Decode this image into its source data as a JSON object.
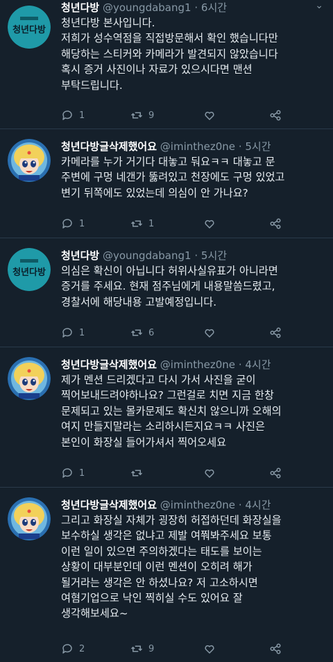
{
  "tweets": [
    {
      "avatar": "youngdabang-logo",
      "avatar_text": "청년다방",
      "name": "청년다방",
      "handle": "@youngdabang1",
      "time": "· 6시간",
      "text": "청년다방 본사입니다.\n저희가 성수역점을 직접방문해서 확인 했습니다만\n해당하는 스티커와 카메라가 발견되지 않았습니다\n혹시 증거 사진이나 자료가 있으시다면 맨션\n부탁드립니다.",
      "replies": "1",
      "retweets": "9",
      "likes": ""
    },
    {
      "avatar": "sailor-moon-avatar",
      "name": "청년다방글삭제했어요",
      "handle": "@iminthez0ne",
      "time": "· 5시간",
      "text": "카메라를 누가 거기다 대놓고 둬요ㅋㅋ 대놓고 문\n주변에 구멍 네갠가 뚫려있고 천장에도 구멍 있었고\n변기 뒤쪽에도 있었는데 의심이 안 가나요?",
      "replies": "1",
      "retweets": "1",
      "likes": ""
    },
    {
      "avatar": "youngdabang-logo",
      "avatar_text": "청년다방",
      "name": "청년다방",
      "handle": "@youngdabang1",
      "time": "· 5시간",
      "text": "의심은 확신이 아닙니다 허위사실유표가 아니라면\n증거를 주세요. 현재 점주님에게 내용말씀드렸고,\n경찰서에 해당내용 고발예정입니다.",
      "replies": "1",
      "retweets": "6",
      "likes": ""
    },
    {
      "avatar": "sailor-moon-avatar",
      "name": "청년다방글삭제했어요",
      "handle": "@iminthez0ne",
      "time": "· 4시간",
      "text": "제가 멘션 드리겠다고 다시 가서 사진을 굳이\n찍어보내드려야하나요? 그런걸로 치면 지금 한창\n문제되고 있는 몰카문제도 확신치 않으니까 오해의\n여지 만들지말라는 소리하시든지요ㅋㅋ 사진은\n본인이 화장실 들어가셔서 찍어오세요",
      "replies": "1",
      "retweets": "",
      "likes": ""
    },
    {
      "avatar": "sailor-moon-avatar",
      "name": "청년다방글삭제했어요",
      "handle": "@iminthez0ne",
      "time": "· 4시간",
      "text": "그리고 화장실 자체가 굉장히 허접하던데 화장실을\n보수하실 생각은 없냐고 제발 여쭤봐주세요 보통\n이런 일이 있으면 주의하겠다는 태도를 보이는\n상황이 대부분인데 이런 멘션이 오히려 해가\n될거라는 생각은 안 하셨나요? 저  고소하시면\n여혐기업으로 낙인 찍히실 수도 있어요 잘\n생각해보세요~",
      "replies": "2",
      "retweets": "9",
      "likes": ""
    }
  ],
  "colors": {
    "background": "#15202b",
    "text": "#e6ecf0",
    "muted": "#8899a6",
    "logo_bg": "#1f9aa8"
  }
}
